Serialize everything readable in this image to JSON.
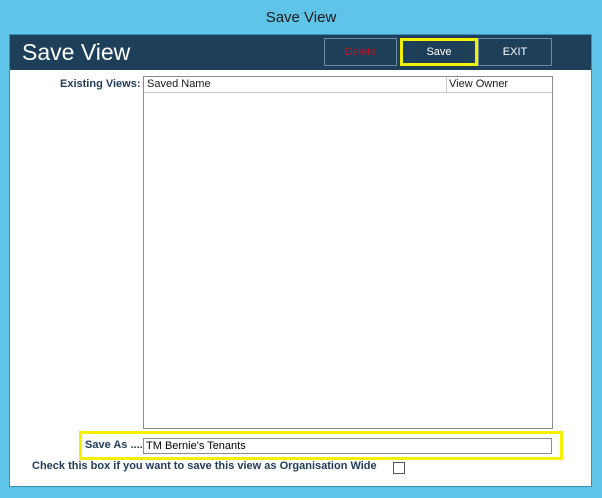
{
  "window_title": "Save View",
  "header": {
    "title": "Save View",
    "delete_label": "Delete",
    "save_label": "Save",
    "exit_label": "EXIT"
  },
  "existing_views": {
    "label": "Existing Views:",
    "columns": [
      "Saved Name",
      "View Owner"
    ],
    "rows": []
  },
  "save_as": {
    "label": "Save As ....",
    "value": "TM Bernie's Tenants"
  },
  "org_wide": {
    "label": "Check this box if you want to save this view as Organisation Wide",
    "checked": false
  },
  "colors": {
    "header_bg": "#1e3f5a",
    "delete_text": "#c0141e",
    "highlight": "#f4f000",
    "frame": "#5fc4e8"
  }
}
